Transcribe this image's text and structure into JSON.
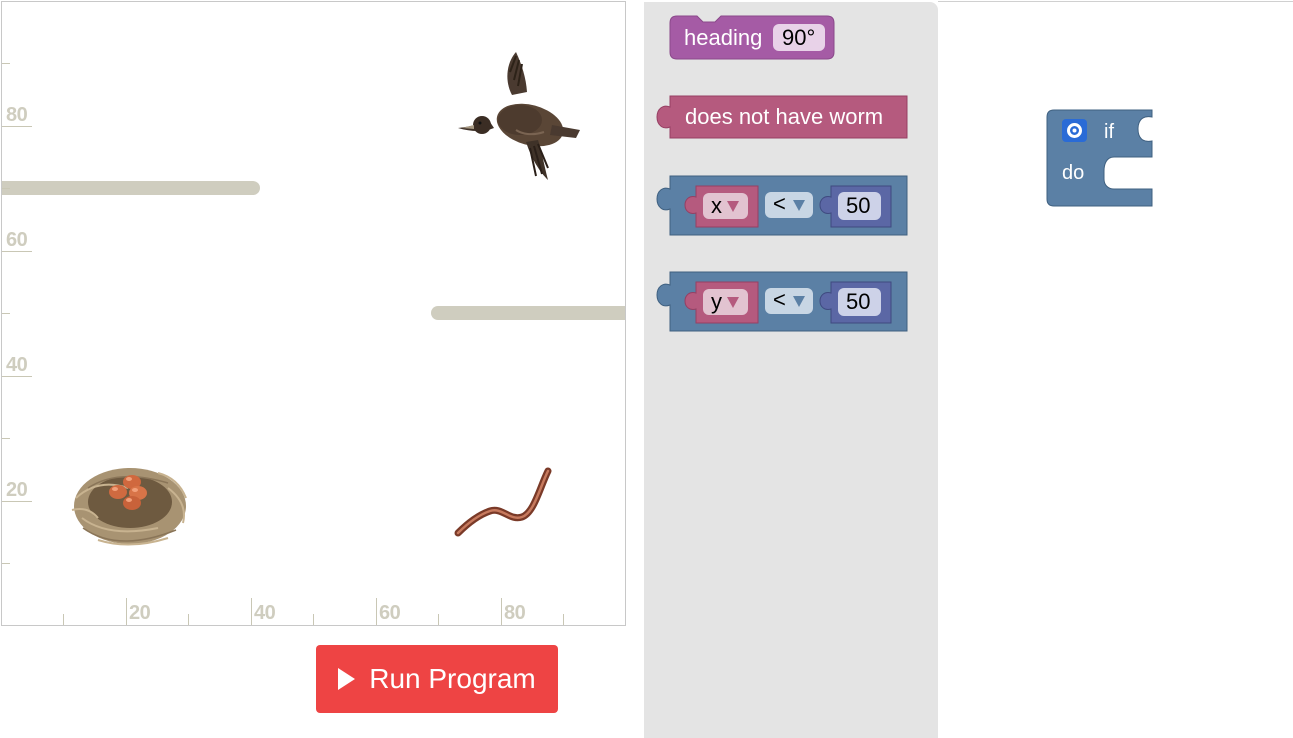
{
  "stage": {
    "y_axis_labels": [
      "80",
      "60",
      "40",
      "20"
    ],
    "x_axis_labels": [
      "20",
      "40",
      "60",
      "80"
    ],
    "sprites": {
      "bird": "bird",
      "nest": "nest",
      "worm": "worm"
    }
  },
  "run_button": {
    "label": "Run Program"
  },
  "flyout": {
    "heading_block": {
      "label": "heading",
      "value": "90°"
    },
    "worm_block": {
      "label": "does not have worm"
    },
    "compare_x": {
      "var": "x",
      "op": "<",
      "value": "50"
    },
    "compare_y": {
      "var": "y",
      "op": "<",
      "value": "50"
    }
  },
  "workspace": {
    "if_block": {
      "if_label": "if",
      "do_label": "do"
    }
  },
  "colors": {
    "heading_purple": "#a55ba5",
    "worm_pink": "#b55a7e",
    "logic_blue": "#5b80a5",
    "math_blue": "#5b67a5",
    "run_red": "#ee4444",
    "wall": "#cfcdbf"
  }
}
